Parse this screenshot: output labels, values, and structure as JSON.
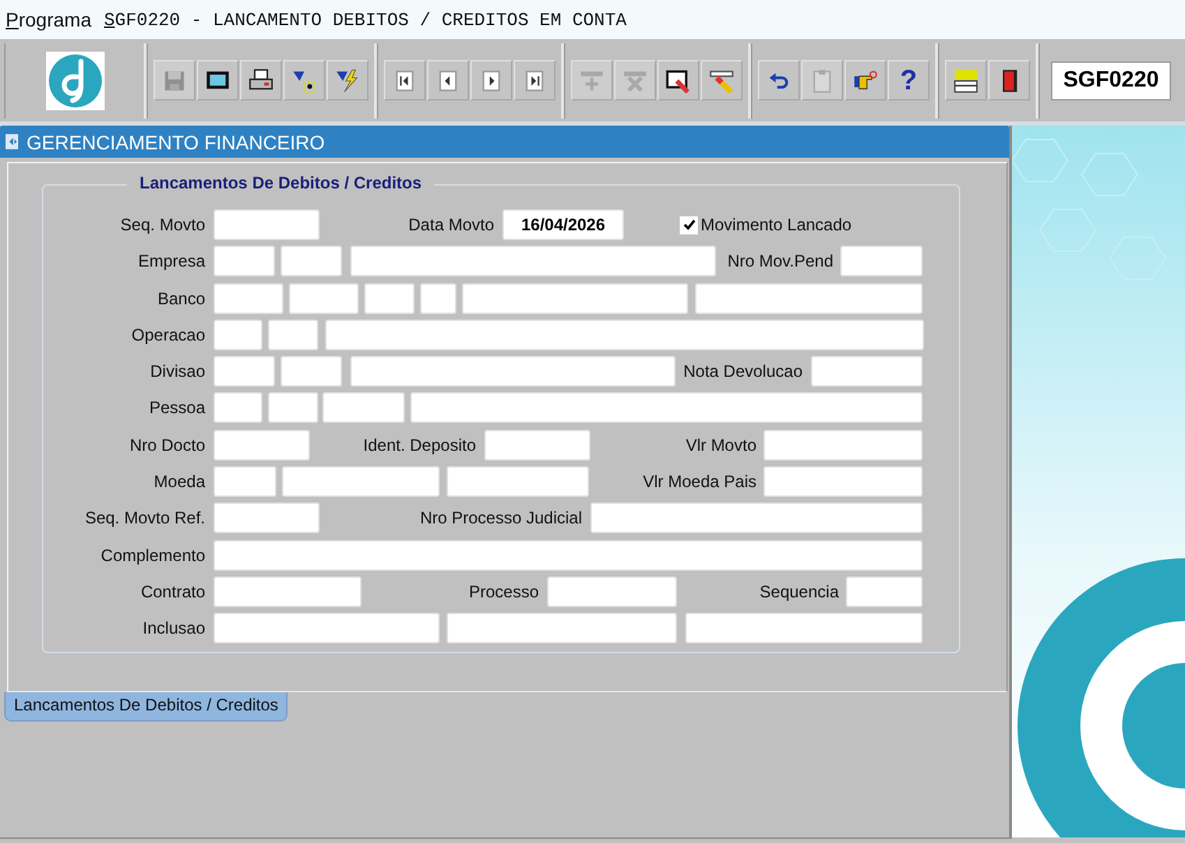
{
  "title_bar": {
    "label": "Programa",
    "program": "SGF0220 - LANCAMENTO DEBITOS / CREDITOS EM CONTA"
  },
  "toolbar": {
    "groups": [
      [
        {
          "kind": "save",
          "disabled": true
        },
        {
          "kind": "window",
          "disabled": false
        },
        {
          "kind": "print",
          "disabled": false
        },
        {
          "kind": "query",
          "disabled": false
        },
        {
          "kind": "execute",
          "disabled": false
        }
      ],
      [
        {
          "kind": "first",
          "disabled": false
        },
        {
          "kind": "prev",
          "disabled": false
        },
        {
          "kind": "next",
          "disabled": false
        },
        {
          "kind": "last",
          "disabled": false
        }
      ],
      [
        {
          "kind": "insert",
          "disabled": true
        },
        {
          "kind": "delete",
          "disabled": true
        },
        {
          "kind": "edit",
          "disabled": false
        },
        {
          "kind": "eraser",
          "disabled": false
        }
      ],
      [
        {
          "kind": "undo",
          "disabled": false
        },
        {
          "kind": "clipboard",
          "disabled": true
        },
        {
          "kind": "hand",
          "disabled": false
        },
        {
          "kind": "help",
          "disabled": false,
          "text": "?"
        }
      ],
      [
        {
          "kind": "new",
          "disabled": false
        },
        {
          "kind": "exit",
          "disabled": false
        }
      ]
    ],
    "program_code": "SGF0220"
  },
  "window": {
    "title": "GERENCIAMENTO FINANCEIRO",
    "section": "Lancamentos De Debitos / Creditos",
    "rows": [
      [
        {
          "kind": "label",
          "text": "Seq. Movto"
        },
        {
          "kind": "field"
        },
        {
          "kind": "label",
          "text": "Data Movto"
        },
        {
          "kind": "field",
          "value": "16/04/2026"
        },
        {
          "kind": "checkbox",
          "text": "Movimento Lancado",
          "checked": true
        }
      ],
      [
        {
          "kind": "label",
          "text": "Empresa"
        },
        {
          "kind": "field"
        },
        {
          "kind": "field"
        },
        {
          "kind": "field"
        },
        {
          "kind": "label",
          "text": "Nro Mov.Pend"
        },
        {
          "kind": "field"
        }
      ],
      [
        {
          "kind": "label",
          "text": "Banco"
        },
        {
          "kind": "field"
        },
        {
          "kind": "field"
        },
        {
          "kind": "field"
        },
        {
          "kind": "field"
        },
        {
          "kind": "field"
        },
        {
          "kind": "field"
        }
      ],
      [
        {
          "kind": "label",
          "text": "Operacao"
        },
        {
          "kind": "field"
        },
        {
          "kind": "field"
        },
        {
          "kind": "field"
        }
      ],
      [
        {
          "kind": "label",
          "text": "Divisao"
        },
        {
          "kind": "field"
        },
        {
          "kind": "field"
        },
        {
          "kind": "field"
        },
        {
          "kind": "label",
          "text": "Nota Devolucao"
        },
        {
          "kind": "field"
        }
      ],
      [
        {
          "kind": "label",
          "text": "Pessoa"
        },
        {
          "kind": "field"
        },
        {
          "kind": "field"
        },
        {
          "kind": "field"
        },
        {
          "kind": "field"
        }
      ],
      [
        {
          "kind": "label",
          "text": "Nro Docto"
        },
        {
          "kind": "field"
        },
        {
          "kind": "label",
          "text": "Ident. Deposito"
        },
        {
          "kind": "field"
        },
        {
          "kind": "label",
          "text": "Vlr Movto"
        },
        {
          "kind": "field"
        }
      ],
      [
        {
          "kind": "label",
          "text": "Moeda"
        },
        {
          "kind": "field"
        },
        {
          "kind": "field"
        },
        {
          "kind": "field"
        },
        {
          "kind": "label",
          "text": "Vlr Moeda Pais"
        },
        {
          "kind": "field"
        }
      ],
      [
        {
          "kind": "label",
          "text": "Seq. Movto Ref."
        },
        {
          "kind": "field"
        },
        {
          "kind": "label",
          "text": "Nro Processo Judicial"
        },
        {
          "kind": "field"
        }
      ],
      [
        {
          "kind": "label",
          "text": "Complemento"
        },
        {
          "kind": "field"
        }
      ],
      [
        {
          "kind": "label",
          "text": "Contrato"
        },
        {
          "kind": "field"
        },
        {
          "kind": "label",
          "text": "Processo"
        },
        {
          "kind": "field"
        },
        {
          "kind": "label",
          "text": "Sequencia"
        },
        {
          "kind": "field"
        }
      ],
      [
        {
          "kind": "label",
          "text": "Inclusao"
        },
        {
          "kind": "field"
        },
        {
          "kind": "field"
        },
        {
          "kind": "field"
        }
      ]
    ],
    "tabs": [
      {
        "label": "Lancamentos De Debitos / Creditos",
        "selected": true
      }
    ]
  }
}
